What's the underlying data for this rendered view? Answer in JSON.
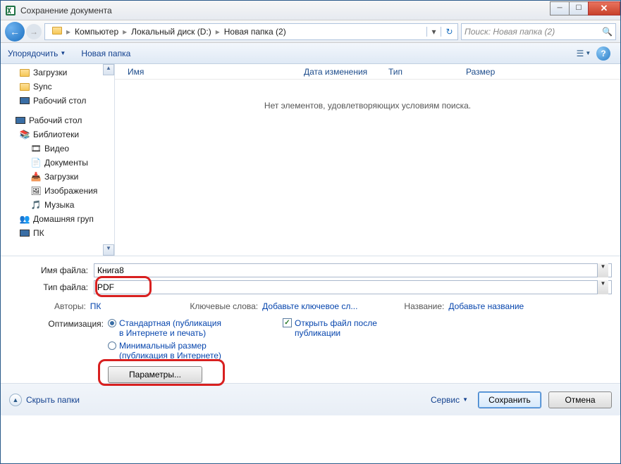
{
  "window": {
    "title": "Сохранение документа"
  },
  "breadcrumb": {
    "segments": [
      "Компьютер",
      "Локальный диск (D:)",
      "Новая папка (2)"
    ],
    "search_placeholder": "Поиск: Новая папка (2)"
  },
  "toolbar": {
    "organize": "Упорядочить",
    "newfolder": "Новая папка"
  },
  "sidebar": {
    "downloads": "Загрузки",
    "sync": "Sync",
    "desktop1": "Рабочий стол",
    "desktop2": "Рабочий стол",
    "libraries": "Библиотеки",
    "video": "Видео",
    "documents": "Документы",
    "downloads2": "Загрузки",
    "images": "Изображения",
    "music": "Музыка",
    "homegroup": "Домашняя груп",
    "pc": "ПК"
  },
  "columns": {
    "name": "Имя",
    "date": "Дата изменения",
    "type": "Тип",
    "size": "Размер"
  },
  "content": {
    "empty": "Нет элементов, удовлетворяющих условиям поиска."
  },
  "fields": {
    "name_label": "Имя файла:",
    "name_value": "Книга8",
    "type_label": "Тип файла:",
    "type_value": "PDF"
  },
  "meta": {
    "authors_label": "Авторы:",
    "authors_value": "ПК",
    "keywords_label": "Ключевые слова:",
    "keywords_value": "Добавьте ключевое сл...",
    "title_label": "Название:",
    "title_value": "Добавьте название"
  },
  "optimize": {
    "label": "Оптимизация:",
    "standard": "Стандартная (публикация в Интернете и печать)",
    "minimal": "Минимальный размер (публикация в Интернете)",
    "open_after": "Открыть файл после публикации",
    "params_button": "Параметры..."
  },
  "footer": {
    "hide_folders": "Скрыть папки",
    "service": "Сервис",
    "save": "Сохранить",
    "cancel": "Отмена"
  }
}
